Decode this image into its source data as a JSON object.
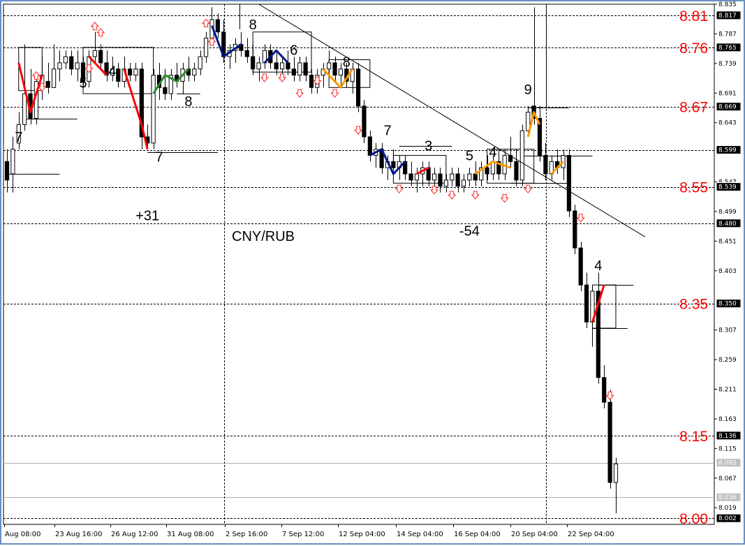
{
  "chart_data": {
    "type": "candlestick",
    "symbol": "CNY/RUB",
    "y_range": [
      8.0,
      8.835
    ],
    "price_ticks": [
      "8.835",
      "8.787",
      "8.739",
      "8.691",
      "8.643",
      "8.547",
      "8.499",
      "8.451",
      "8.403",
      "8.307",
      "8.259",
      "8.211",
      "8.163",
      "8.115",
      "8.067",
      "8.019"
    ],
    "price_badges": [
      {
        "label": "8.817",
        "value": 8.817,
        "style": "dark"
      },
      {
        "label": "8.765",
        "value": 8.765,
        "style": "dark"
      },
      {
        "label": "8.669",
        "value": 8.669,
        "style": "dark"
      },
      {
        "label": "8.599",
        "value": 8.599,
        "style": "dark"
      },
      {
        "label": "8.539",
        "value": 8.539,
        "style": "dark"
      },
      {
        "label": "8.480",
        "value": 8.48,
        "style": "dark"
      },
      {
        "label": "8.350",
        "value": 8.35,
        "style": "dark"
      },
      {
        "label": "8.136",
        "value": 8.136,
        "style": "dark"
      },
      {
        "label": "8.092",
        "value": 8.092,
        "style": "grey"
      },
      {
        "label": "8.036",
        "value": 8.036,
        "style": "grey"
      },
      {
        "label": "8.002",
        "value": 8.002,
        "style": "dark"
      }
    ],
    "levels": [
      {
        "label": "8.81",
        "value": 8.817
      },
      {
        "label": "8.76",
        "value": 8.765
      },
      {
        "label": "8.67",
        "value": 8.669
      },
      {
        "label": "8.55",
        "value": 8.539
      },
      {
        "label": "8.35",
        "value": 8.35
      },
      {
        "label": "8.15",
        "value": 8.136
      },
      {
        "label": "8.00",
        "value": 8.002
      }
    ],
    "time_labels": [
      "Aug 08:00",
      "23 Aug 16:00",
      "26 Aug 12:00",
      "31 Aug 08:00",
      "2 Sep 16:00",
      "7 Sep 12:00",
      "12 Sep 04:00",
      "14 Sep 04:00",
      "16 Sep 04:00",
      "20 Sep 04:00",
      "22 Sep 04:00"
    ],
    "counts": [
      {
        "text": "7",
        "i": 2,
        "v": 8.612
      },
      {
        "text": "5",
        "i": 13,
        "v": 8.7
      },
      {
        "text": "4",
        "i": 18,
        "v": 8.719
      },
      {
        "text": "7",
        "i": 26,
        "v": 8.58
      },
      {
        "text": "8",
        "i": 31,
        "v": 8.67
      },
      {
        "text": "8",
        "i": 42,
        "v": 8.794
      },
      {
        "text": "6",
        "i": 49,
        "v": 8.753
      },
      {
        "text": "8",
        "i": 58,
        "v": 8.734
      },
      {
        "text": "7",
        "i": 65,
        "v": 8.623
      },
      {
        "text": "3",
        "i": 72,
        "v": 8.598
      },
      {
        "text": "5",
        "i": 79,
        "v": 8.582
      },
      {
        "text": "4",
        "i": 83,
        "v": 8.588
      },
      {
        "text": "9",
        "i": 89,
        "v": 8.689
      },
      {
        "text": "4",
        "i": 101,
        "v": 8.404
      }
    ],
    "notes": [
      {
        "text": "+31",
        "i": 24,
        "v": 8.485
      },
      {
        "text": "-54",
        "i": 79,
        "v": 8.46
      }
    ],
    "trendline": {
      "from": {
        "i": 43,
        "v": 8.835
      },
      "to": {
        "i": 109,
        "v": 8.458
      }
    },
    "candles": [
      [
        8.58,
        8.6,
        8.53,
        8.55
      ],
      [
        8.56,
        8.62,
        8.53,
        8.6
      ],
      [
        8.61,
        8.66,
        8.6,
        8.64
      ],
      [
        8.64,
        8.77,
        8.63,
        8.69
      ],
      [
        8.69,
        8.73,
        8.64,
        8.65
      ],
      [
        8.65,
        8.72,
        8.64,
        8.71
      ],
      [
        8.7,
        8.75,
        8.68,
        8.72
      ],
      [
        8.71,
        8.74,
        8.69,
        8.7
      ],
      [
        8.7,
        8.77,
        8.7,
        8.73
      ],
      [
        8.73,
        8.76,
        8.71,
        8.74
      ],
      [
        8.74,
        8.76,
        8.73,
        8.75
      ],
      [
        8.75,
        8.76,
        8.72,
        8.73
      ],
      [
        8.73,
        8.76,
        8.71,
        8.74
      ],
      [
        8.74,
        8.75,
        8.7,
        8.71
      ],
      [
        8.71,
        8.76,
        8.7,
        8.75
      ],
      [
        8.75,
        8.79,
        8.74,
        8.76
      ],
      [
        8.76,
        8.77,
        8.73,
        8.74
      ],
      [
        8.74,
        8.76,
        8.71,
        8.72
      ],
      [
        8.72,
        8.75,
        8.71,
        8.73
      ],
      [
        8.73,
        8.74,
        8.7,
        8.71
      ],
      [
        8.71,
        8.75,
        8.7,
        8.73
      ],
      [
        8.73,
        8.74,
        8.71,
        8.72
      ],
      [
        8.72,
        8.74,
        8.71,
        8.73
      ],
      [
        8.73,
        8.74,
        8.6,
        8.62
      ],
      [
        8.62,
        8.64,
        8.6,
        8.61
      ],
      [
        8.61,
        8.73,
        8.6,
        8.72
      ],
      [
        8.72,
        8.74,
        8.68,
        8.7
      ],
      [
        8.7,
        8.73,
        8.68,
        8.69
      ],
      [
        8.69,
        8.73,
        8.68,
        8.72
      ],
      [
        8.72,
        8.74,
        8.7,
        8.71
      ],
      [
        8.71,
        8.74,
        8.69,
        8.73
      ],
      [
        8.73,
        8.75,
        8.71,
        8.72
      ],
      [
        8.72,
        8.74,
        8.71,
        8.73
      ],
      [
        8.73,
        8.76,
        8.72,
        8.75
      ],
      [
        8.75,
        8.79,
        8.74,
        8.78
      ],
      [
        8.78,
        8.83,
        8.77,
        8.81
      ],
      [
        8.81,
        8.82,
        8.78,
        8.79
      ],
      [
        8.79,
        8.81,
        8.74,
        8.75
      ],
      [
        8.75,
        8.77,
        8.73,
        8.76
      ],
      [
        8.76,
        8.78,
        8.74,
        8.77
      ],
      [
        8.77,
        8.79,
        8.75,
        8.76
      ],
      [
        8.76,
        8.78,
        8.74,
        8.75
      ],
      [
        8.75,
        8.77,
        8.72,
        8.73
      ],
      [
        8.73,
        8.75,
        8.71,
        8.74
      ],
      [
        8.74,
        8.77,
        8.73,
        8.76
      ],
      [
        8.76,
        8.77,
        8.73,
        8.74
      ],
      [
        8.74,
        8.76,
        8.72,
        8.73
      ],
      [
        8.73,
        8.75,
        8.72,
        8.74
      ],
      [
        8.74,
        8.76,
        8.72,
        8.73
      ],
      [
        8.73,
        8.75,
        8.71,
        8.72
      ],
      [
        8.72,
        8.75,
        8.71,
        8.74
      ],
      [
        8.74,
        8.75,
        8.71,
        8.72
      ],
      [
        8.72,
        8.73,
        8.69,
        8.7
      ],
      [
        8.7,
        8.73,
        8.69,
        8.72
      ],
      [
        8.72,
        8.74,
        8.7,
        8.73
      ],
      [
        8.73,
        8.76,
        8.72,
        8.74
      ],
      [
        8.74,
        8.75,
        8.71,
        8.72
      ],
      [
        8.72,
        8.74,
        8.7,
        8.73
      ],
      [
        8.73,
        8.74,
        8.7,
        8.71
      ],
      [
        8.71,
        8.74,
        8.69,
        8.73
      ],
      [
        8.73,
        8.74,
        8.66,
        8.67
      ],
      [
        8.67,
        8.68,
        8.61,
        8.62
      ],
      [
        8.62,
        8.63,
        8.58,
        8.59
      ],
      [
        8.59,
        8.61,
        8.57,
        8.6
      ],
      [
        8.6,
        8.61,
        8.56,
        8.57
      ],
      [
        8.57,
        8.59,
        8.55,
        8.58
      ],
      [
        8.58,
        8.6,
        8.56,
        8.57
      ],
      [
        8.57,
        8.59,
        8.55,
        8.58
      ],
      [
        8.58,
        8.59,
        8.55,
        8.56
      ],
      [
        8.56,
        8.58,
        8.54,
        8.55
      ],
      [
        8.55,
        8.57,
        8.53,
        8.56
      ],
      [
        8.56,
        8.58,
        8.54,
        8.57
      ],
      [
        8.57,
        8.58,
        8.54,
        8.55
      ],
      [
        8.55,
        8.57,
        8.53,
        8.56
      ],
      [
        8.56,
        8.57,
        8.53,
        8.54
      ],
      [
        8.54,
        8.56,
        8.53,
        8.55
      ],
      [
        8.55,
        8.57,
        8.54,
        8.56
      ],
      [
        8.56,
        8.57,
        8.53,
        8.54
      ],
      [
        8.54,
        8.56,
        8.53,
        8.55
      ],
      [
        8.55,
        8.57,
        8.54,
        8.56
      ],
      [
        8.56,
        8.58,
        8.54,
        8.55
      ],
      [
        8.55,
        8.58,
        8.54,
        8.57
      ],
      [
        8.57,
        8.59,
        8.55,
        8.56
      ],
      [
        8.56,
        8.59,
        8.55,
        8.58
      ],
      [
        8.58,
        8.6,
        8.55,
        8.56
      ],
      [
        8.56,
        8.6,
        8.55,
        8.59
      ],
      [
        8.59,
        8.62,
        8.57,
        8.58
      ],
      [
        8.58,
        8.6,
        8.54,
        8.55
      ],
      [
        8.55,
        8.64,
        8.54,
        8.63
      ],
      [
        8.63,
        8.67,
        8.62,
        8.66
      ],
      [
        8.67,
        8.83,
        8.64,
        8.65
      ],
      [
        8.65,
        8.67,
        8.58,
        8.59
      ],
      [
        8.59,
        8.61,
        8.55,
        8.56
      ],
      [
        8.56,
        8.59,
        8.55,
        8.58
      ],
      [
        8.58,
        8.6,
        8.56,
        8.57
      ],
      [
        8.57,
        8.6,
        8.55,
        8.59
      ],
      [
        8.59,
        8.6,
        8.49,
        8.5
      ],
      [
        8.5,
        8.51,
        8.43,
        8.44
      ],
      [
        8.44,
        8.45,
        8.37,
        8.38
      ],
      [
        8.38,
        8.4,
        8.31,
        8.32
      ],
      [
        8.32,
        8.38,
        8.28,
        8.37
      ],
      [
        8.37,
        8.4,
        8.22,
        8.23
      ],
      [
        8.23,
        8.25,
        8.18,
        8.19
      ],
      [
        8.19,
        8.21,
        8.05,
        8.06
      ],
      [
        8.06,
        8.1,
        8.01,
        8.09
      ]
    ],
    "zigzag": [
      {
        "color": "#ff0000",
        "pts": [
          [
            2,
            8.74
          ],
          [
            4,
            8.66
          ],
          [
            6,
            8.72
          ]
        ]
      },
      {
        "color": "#ff0000",
        "pts": [
          [
            14,
            8.75
          ],
          [
            17,
            8.72
          ]
        ]
      },
      {
        "color": "#ff0000",
        "pts": [
          [
            20,
            8.73
          ],
          [
            23,
            8.64
          ],
          [
            24,
            8.6
          ]
        ]
      },
      {
        "color": "#2a8a2a",
        "pts": [
          [
            25,
            8.69
          ],
          [
            27,
            8.72
          ],
          [
            29,
            8.71
          ],
          [
            31,
            8.73
          ]
        ]
      },
      {
        "color": "#001a88",
        "pts": [
          [
            35,
            8.8
          ],
          [
            37,
            8.75
          ],
          [
            40,
            8.77
          ]
        ]
      },
      {
        "color": "#001a88",
        "pts": [
          [
            44,
            8.74
          ],
          [
            46,
            8.76
          ],
          [
            48,
            8.74
          ]
        ]
      },
      {
        "color": "#ff9900",
        "pts": [
          [
            54,
            8.73
          ],
          [
            57,
            8.7
          ],
          [
            59,
            8.73
          ]
        ]
      },
      {
        "color": "#001a88",
        "pts": [
          [
            62,
            8.59
          ],
          [
            64,
            8.6
          ],
          [
            66,
            8.56
          ],
          [
            68,
            8.58
          ]
        ]
      },
      {
        "color": "#ff0000",
        "pts": [
          [
            70,
            8.56
          ],
          [
            72,
            8.57
          ]
        ]
      },
      {
        "color": "#ff9900",
        "pts": [
          [
            80,
            8.56
          ],
          [
            83,
            8.58
          ],
          [
            86,
            8.57
          ]
        ]
      },
      {
        "color": "#ff9900",
        "pts": [
          [
            89,
            8.62
          ],
          [
            90,
            8.66
          ],
          [
            91,
            8.64
          ]
        ]
      },
      {
        "color": "#ff9900",
        "pts": [
          [
            93,
            8.56
          ],
          [
            95,
            8.58
          ]
        ]
      },
      {
        "color": "#ff0000",
        "pts": [
          [
            100,
            8.32
          ],
          [
            102,
            8.38
          ]
        ]
      }
    ],
    "arrows": {
      "up": [
        [
          5,
          8.72
        ],
        [
          15,
          8.8
        ],
        [
          16,
          8.79
        ],
        [
          34,
          8.805
        ],
        [
          35,
          8.775
        ]
      ],
      "down": [
        [
          6,
          8.7
        ],
        [
          14,
          8.73
        ],
        [
          44,
          8.715
        ],
        [
          47,
          8.715
        ],
        [
          50,
          8.69
        ],
        [
          53,
          8.71
        ],
        [
          56,
          8.69
        ],
        [
          60,
          8.63
        ],
        [
          67,
          8.535
        ],
        [
          73,
          8.533
        ],
        [
          76,
          8.525
        ],
        [
          80,
          8.525
        ],
        [
          85,
          8.52
        ],
        [
          89,
          8.535
        ],
        [
          98,
          8.488
        ],
        [
          103,
          8.2
        ]
      ]
    },
    "boxes": [
      {
        "i0": 2,
        "i1": 6,
        "v0": 8.695,
        "v1": 8.765
      },
      {
        "i0": 13,
        "i1": 25,
        "v0": 8.69,
        "v1": 8.765
      },
      {
        "i0": 42,
        "i1": 52,
        "v0": 8.725,
        "v1": 8.79
      },
      {
        "i0": 55,
        "i1": 62,
        "v0": 8.7,
        "v1": 8.745
      },
      {
        "i0": 66,
        "i1": 75,
        "v0": 8.545,
        "v1": 8.59
      },
      {
        "i0": 82,
        "i1": 90,
        "v0": 8.545,
        "v1": 8.6
      },
      {
        "i0": 100,
        "i1": 104,
        "v0": 8.31,
        "v1": 8.38
      }
    ],
    "hsegs": [
      {
        "i0": 0,
        "i1": 9,
        "v": 8.56
      },
      {
        "i0": 3,
        "i1": 12,
        "v": 8.65
      },
      {
        "i0": 24,
        "i1": 36,
        "v": 8.595
      },
      {
        "i0": 29,
        "i1": 33,
        "v": 8.69
      },
      {
        "i0": 67,
        "i1": 76,
        "v": 8.605
      },
      {
        "i0": 86,
        "i1": 96,
        "v": 8.545
      },
      {
        "i0": 89,
        "i1": 96,
        "v": 8.668
      },
      {
        "i0": 101,
        "i1": 107,
        "v": 8.38
      },
      {
        "i0": 100,
        "i1": 106,
        "v": 8.31
      },
      {
        "i0": 88,
        "i1": 100,
        "v": 8.59
      }
    ]
  }
}
